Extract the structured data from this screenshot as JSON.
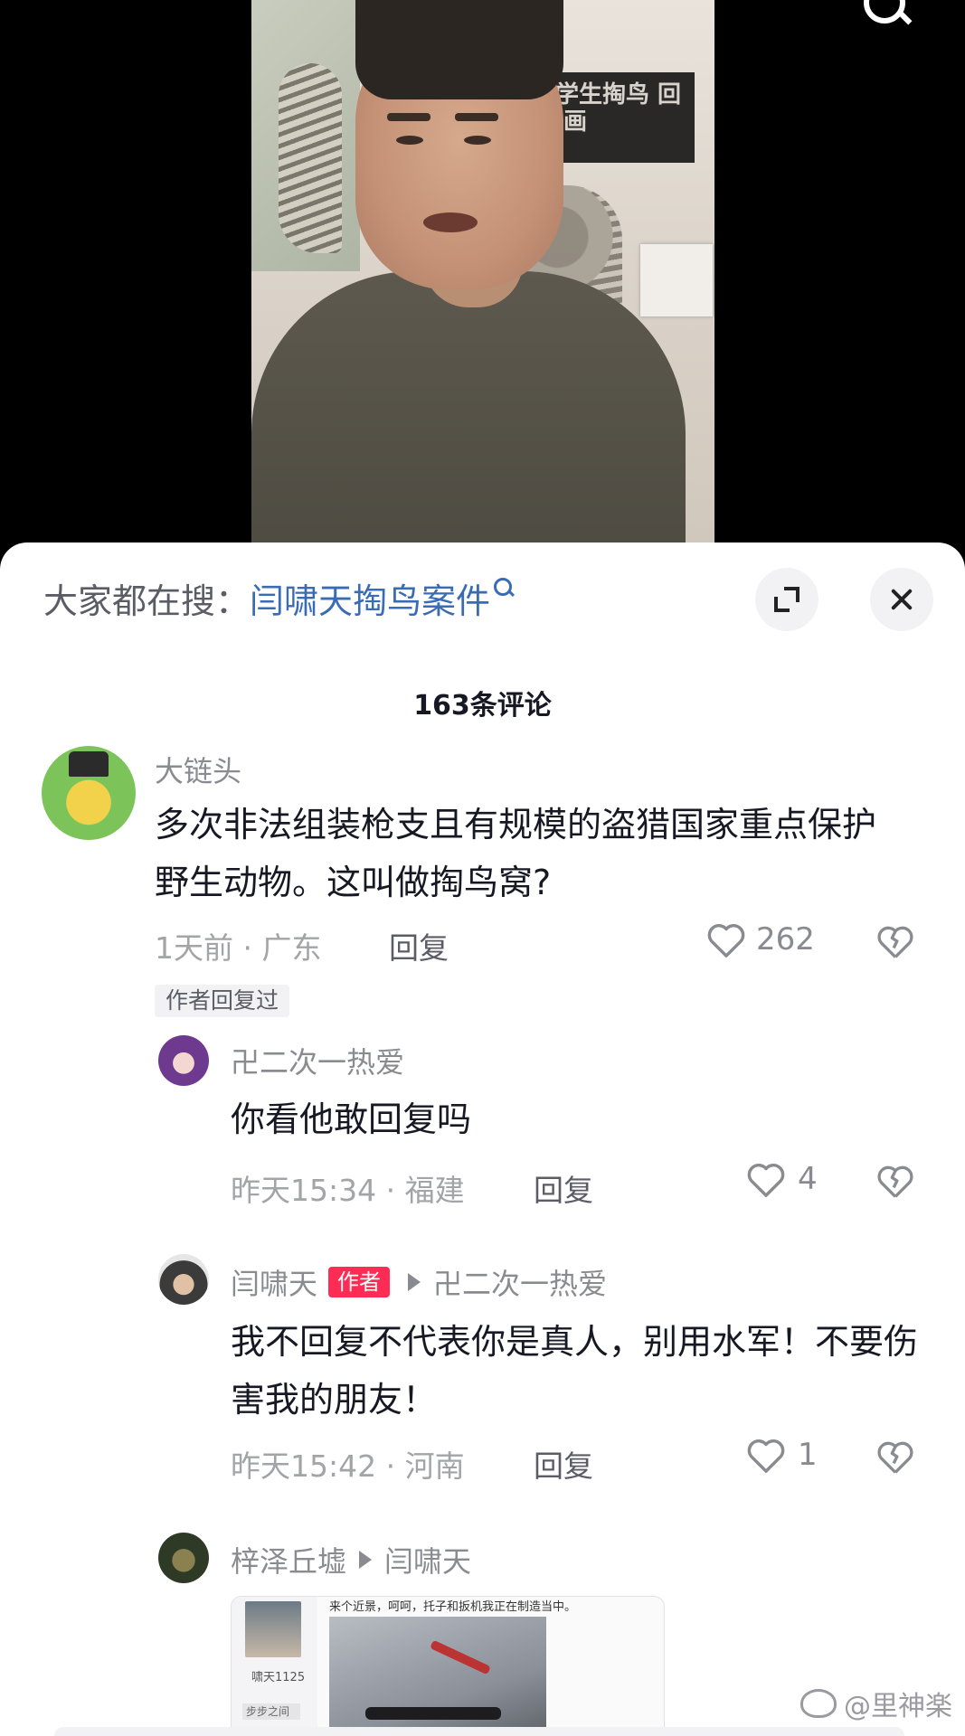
{
  "video": {
    "poster_text": "大学生掏鸟 回归 画"
  },
  "search": {
    "prefix": "大家都在搜：",
    "term": "闫啸天掏鸟案件"
  },
  "comments_title": "163条评论",
  "comments": [
    {
      "username": "大链头",
      "text": "多次非法组装枪支且有规模的盗猎国家重点保护野生动物。这叫做掏鸟窝?",
      "time_location": "1天前 · 广东",
      "reply_label": "回复",
      "likes": "262",
      "badge": "作者回复过"
    }
  ],
  "replies": [
    {
      "username": "卍二次一热爱",
      "text": "你看他敢回复吗",
      "time_location": "昨天15:34 · 福建",
      "reply_label": "回复",
      "likes": "4"
    },
    {
      "username": "闫啸天",
      "author_tag": "作者",
      "reply_to": "卍二次一热爱",
      "text": "我不回复不代表你是真人，别用水军！不要伤害我的朋友！",
      "time_location": "昨天15:42 · 河南",
      "reply_label": "回复",
      "likes": "1"
    },
    {
      "username": "梓泽丘墟",
      "reply_to": "闫啸天",
      "image": {
        "caption": "来个近景，呵呵，托子和扳机我正在制造当中。",
        "left_line1": "啸天1125",
        "left_line2": "步步之间"
      }
    }
  ],
  "watermark": "@里神楽",
  "colors": {
    "accent_red": "#fe2c55",
    "search_link": "#3a6cb5"
  }
}
